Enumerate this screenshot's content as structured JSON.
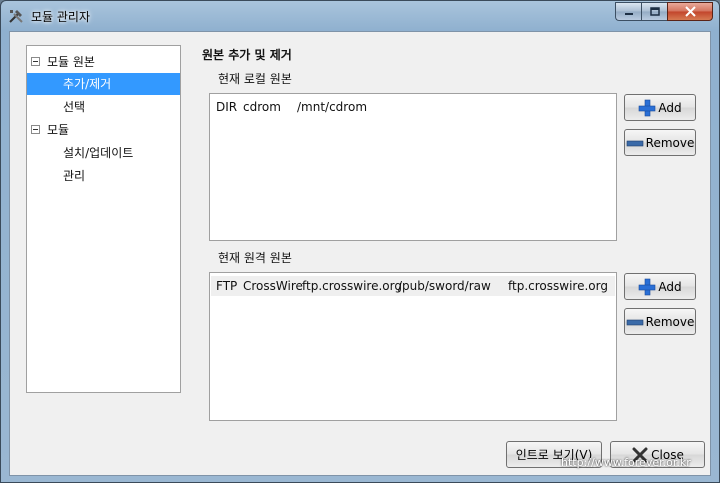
{
  "window": {
    "title": "모듈 관리자",
    "icon": "tools-icon",
    "minimize": "minimize-icon",
    "maximize": "maximize-icon",
    "close": "close-icon"
  },
  "tree": {
    "items": [
      {
        "label": "모듈 원본",
        "level": 0,
        "expanded": true
      },
      {
        "label": "추가/제거",
        "level": 1,
        "selected": true
      },
      {
        "label": "선택",
        "level": 1
      },
      {
        "label": "모듈",
        "level": 0,
        "expanded": true
      },
      {
        "label": "설치/업데이트",
        "level": 1
      },
      {
        "label": "관리",
        "level": 1
      }
    ]
  },
  "main": {
    "heading": "원본 추가 및 제거",
    "local": {
      "label": "현재 로컬 원본",
      "rows": [
        {
          "type": "DIR",
          "name": "cdrom",
          "path": "/mnt/cdrom"
        }
      ],
      "add_label": "Add",
      "remove_label": "Remove"
    },
    "remote": {
      "label": "현재 원격 원본",
      "rows": [
        {
          "type": "FTP",
          "name": "CrossWire",
          "host": "ftp.crosswire.org",
          "path": "/pub/sword/raw",
          "mirror": "ftp.crosswire.org"
        }
      ],
      "add_label": "Add",
      "remove_label": "Remove"
    }
  },
  "footer": {
    "intro_label": "인트로 보기(V)",
    "close_label": "Close",
    "watermark": "http://www.forever.or.kr"
  },
  "colors": {
    "selection": "#3399ff",
    "add_icon": "#2a6fd6",
    "remove_icon": "#3a6aa8",
    "close_icon": "#333333"
  }
}
